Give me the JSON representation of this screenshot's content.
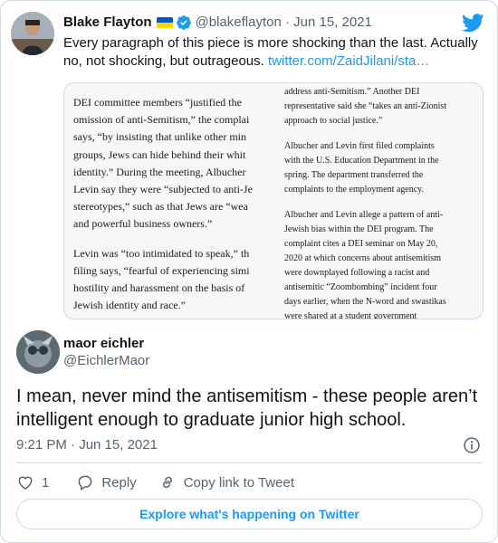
{
  "quoted_tweet": {
    "author_name": "Blake Flayton",
    "flag_icon": "ukraine-flag-icon",
    "flag_colors": [
      "#005bbb",
      "#ffd500"
    ],
    "verified_icon": "verified-badge-icon",
    "handle_date": "@blakeflayton · Jun 15, 2021",
    "text": "Every paragraph of this piece is more shocking than the last. Actually no, not shocking, but outrageous. ",
    "link": "twitter.com/ZaidJilani/sta…",
    "image": {
      "left_column": [
        [
          "DEI committee members “justified the",
          "omission of anti-Semitism,” the complai",
          "says, “by insisting that unlike other min",
          "groups, Jews can hide behind their whit",
          "identity.” During the meeting, Albucher",
          "Levin say they were “subjected to anti-Je",
          "stereotypes,” such as that Jews are “wea",
          "and powerful business owners.”"
        ],
        [
          "Levin was “too intimidated to speak,” th",
          "filing says, “fearful of experiencing simi",
          "hostility and harassment on the basis of",
          "Jewish identity and race.”"
        ]
      ],
      "right_column": [
        [
          "address anti-Semitism.” Another DEI",
          "representative said she “takes an anti-Zionist",
          "approach to social justice.”"
        ],
        [
          "Albucher and Levin first filed complaints",
          "with the U.S. Education Department in the",
          "spring. The department transferred the",
          "complaints to the employment agency."
        ],
        [
          "Albucher and Levin allege a pattern of anti-",
          "Jewish bias within the DEI program. The",
          "complaint cites a DEI seminar on May 20,",
          "2020 at which concerns about antisemitism",
          "were downplayed following a racist and",
          "antisemitic “Zoombombing” incident four",
          "days earlier, when the N-word and swastikas",
          "were shared at a student government"
        ]
      ]
    }
  },
  "reply_tweet": {
    "author_name": "maor eichler",
    "handle": "@EichlerMaor",
    "text": "I mean, never mind the antisemitism - these people aren’t intelligent enough to graduate junior high school.",
    "timestamp": "9:21 PM · Jun 15, 2021"
  },
  "actions": {
    "like_count": "1",
    "reply_label": "Reply",
    "copy_label": "Copy link to Tweet"
  },
  "explore_label": "Explore what's happening on Twitter",
  "colors": {
    "accent": "#1d9bf0",
    "text": "#0f1419",
    "secondary_text": "#536471",
    "border": "#cfd9de"
  }
}
